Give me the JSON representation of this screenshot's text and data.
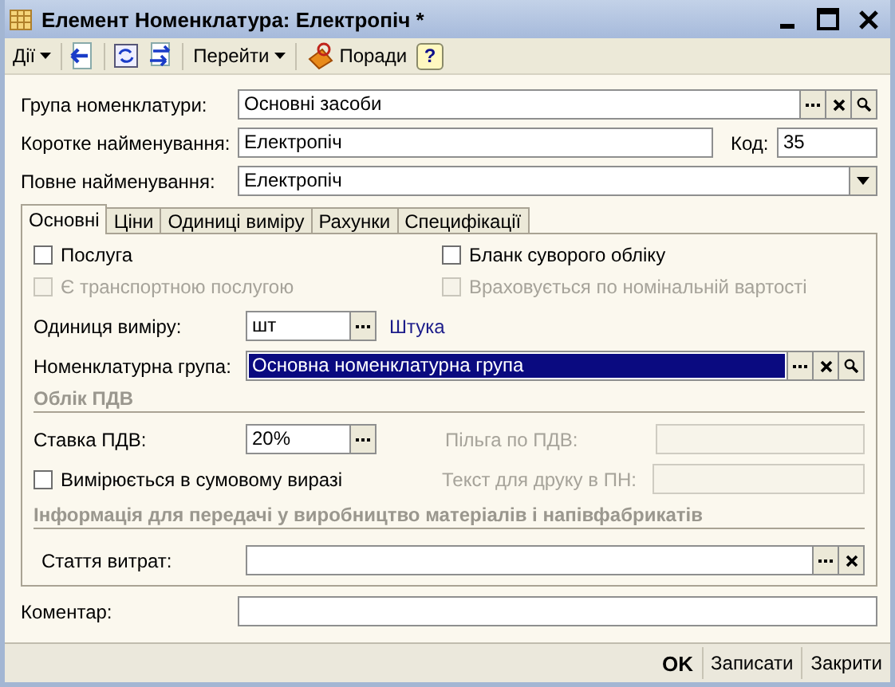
{
  "window": {
    "title": "Елемент Номенклатура: Електропіч *"
  },
  "toolbar": {
    "actions_menu": "Дії",
    "goto_menu": "Перейти",
    "tips_button": "Поради",
    "help_button": "?"
  },
  "header": {
    "group": {
      "label": "Група номенклатури:",
      "value": "Основні засоби"
    },
    "short_name": {
      "label": "Коротке найменування:",
      "value": "Електропіч"
    },
    "code": {
      "label": "Код:",
      "value": "35"
    },
    "full_name": {
      "label": "Повне найменування:",
      "value": "Електропіч"
    }
  },
  "tabs": [
    {
      "label": "Основні",
      "selected": true
    },
    {
      "label": "Ціни",
      "selected": false
    },
    {
      "label": "Одиниці виміру",
      "selected": false
    },
    {
      "label": "Рахунки",
      "selected": false
    },
    {
      "label": "Специфікації",
      "selected": false
    }
  ],
  "main_tab": {
    "checkboxes": [
      {
        "label": "Послуга",
        "checked": false,
        "disabled": false
      },
      {
        "label": "Бланк суворого обліку",
        "checked": false,
        "disabled": false
      },
      {
        "label": "Є транспортною послугою",
        "checked": false,
        "disabled": true
      },
      {
        "label": "Враховується по номінальній вартості",
        "checked": false,
        "disabled": true
      }
    ],
    "unit": {
      "label": "Одиниця виміру:",
      "value": "шт",
      "link": "Штука"
    },
    "nomenclature_group": {
      "label": "Номенклатурна група:",
      "value": "Основна номенклатурна група",
      "selected": true
    },
    "vat_section": {
      "title": "Облік ПДВ",
      "rate": {
        "label": "Ставка ПДВ:",
        "value": "20%"
      },
      "exemption": {
        "label": "Пільга по ПДВ:",
        "disabled": true
      },
      "sum_checkbox": {
        "label": "Вимірюється в сумовому виразі",
        "checked": false
      },
      "print_text": {
        "label": "Текст для друку в ПН:",
        "disabled": true
      }
    },
    "production_section": {
      "title": "Інформація для передачі у виробництво матеріалів і напівфабрикатів",
      "expense_item": {
        "label": "Стаття витрат:"
      }
    }
  },
  "comment": {
    "label": "Коментар:"
  },
  "footer_buttons": [
    {
      "label": "OK",
      "default": true
    },
    {
      "label": "Записати",
      "default": false
    },
    {
      "label": "Закрити",
      "default": false
    }
  ]
}
